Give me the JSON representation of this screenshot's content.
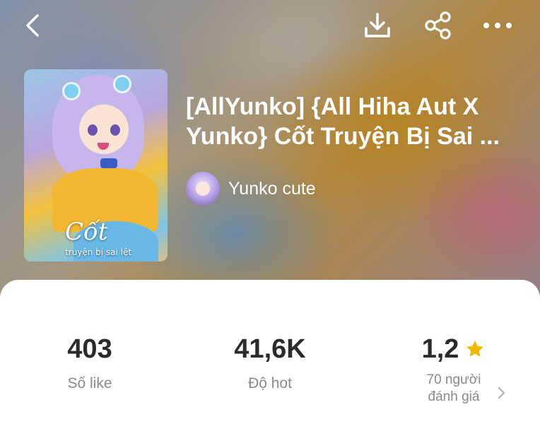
{
  "header": {
    "icons": {
      "back": "chevron-left-icon",
      "download": "download-icon",
      "share": "share-icon",
      "more": "more-horizontal-icon"
    }
  },
  "story": {
    "title": "[AllYunko] {All Hiha Aut X Yunko} Cốt Truyện Bị Sai ...",
    "cover": {
      "title_text": "Cốt",
      "subtitle_text": "truyện bị sai lệt"
    },
    "author": {
      "name": "Yunko cute"
    }
  },
  "stats": {
    "likes": {
      "value": "403",
      "label": "Số like"
    },
    "hot": {
      "value": "41,6K",
      "label": "Độ hot"
    },
    "rating": {
      "value": "1,2",
      "label_line1": "70 người",
      "label_line2": "đánh giá"
    }
  },
  "colors": {
    "star": "#f5b800",
    "stat_value": "#2a2a2a",
    "stat_label": "#8a8a8a"
  }
}
